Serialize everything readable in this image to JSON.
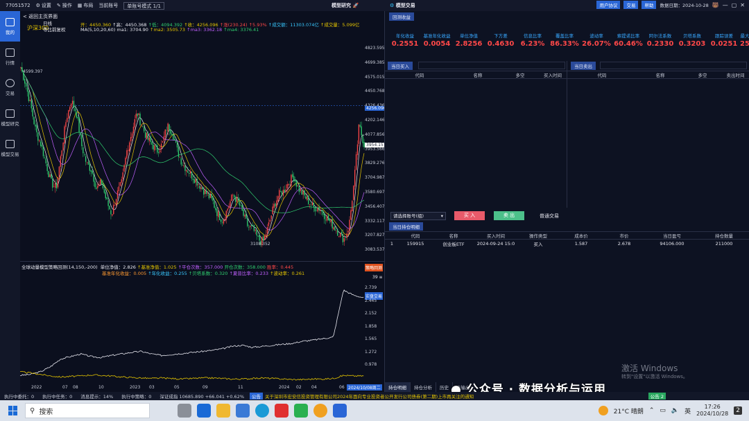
{
  "titlebar": {
    "account_id": "77051572",
    "settings": "设置",
    "operate": "操作",
    "layout": "布局",
    "current_account": "当前账号",
    "account_mode": "单账号模式 1/1",
    "center_title": "模型研究",
    "center_title2": "模型交易",
    "user_agreement": "用户协议",
    "trade": "交易",
    "help": "帮助",
    "data_date": "数据日期：2024-10-28"
  },
  "nav": [
    {
      "label": "我的",
      "active": true
    },
    {
      "label": "行情",
      "active": false
    },
    {
      "label": "交易",
      "active": false
    },
    {
      "label": "模型研究",
      "active": false
    },
    {
      "label": "模型交易",
      "active": false
    }
  ],
  "chart_header": {
    "back": "< 返回主页界面",
    "index_name": "沪深300",
    "period": "日线",
    "adjust": "等比前复权",
    "open": "开：4450.360",
    "high": "↑高：4450.368",
    "low": "↑低：4094.392",
    "close": "↑收：4256.096",
    "change": "↑涨(230.24)",
    "pct": "↑5.93%",
    "amount": "↑成交额：11303.074亿",
    "volume": "↑成交量：5.099亿",
    "ma_label": "MA(5,10,20,60)",
    "ma1": "ma1: 3704.90",
    "ma2": "↑ma2: 3505.73",
    "ma3": "↑ma3: 3362.18",
    "ma4": "↑ma4: 3376.41",
    "high_mark": "4599.397",
    "low_mark": "3108.352"
  },
  "price_axis": [
    "4823.595",
    "4699.385",
    "4575.015",
    "4450.768",
    "4326.436",
    "4202.146",
    "4077.856",
    "3953.566",
    "3829.276",
    "3704.987",
    "3580.697",
    "3456.407",
    "3332.117",
    "3207.827",
    "3083.537"
  ],
  "price_tags": {
    "current": "4256.096",
    "last": "3954.157"
  },
  "strategy": {
    "title": "全球动量模型策略回测(14,150,-200)",
    "unit_nav": "单位净值：2.826",
    "bench_nav": "↑基准净值：1.025",
    "avg_count": "↑平仓次数：357.000",
    "open_count": "开仓次数：358.000",
    "win_rate": "胜率：0.445",
    "bench_annual": "基准年化收益：0.005",
    "annual": "↑年化收益：0.255",
    "beta": "↑贝塔系数：0.320",
    "sharpe": "↑夏普比率：0.233",
    "volatility": "↑波动率：0.261",
    "btn_backtest": "策略回测",
    "btn_live": "实盘交易",
    "right_val": "39 ≡"
  },
  "strategy_axis": [
    "2.739",
    "2.445",
    "2.152",
    "1.858",
    "1.565",
    "1.272",
    "0.978"
  ],
  "x_axis": [
    "2022",
    "07",
    "08",
    "10",
    "2023",
    "03",
    "05",
    "09",
    "11",
    "2024",
    "02",
    "04",
    "06"
  ],
  "x_axis_end": "2024/10/08周二",
  "right": {
    "return_tab": "回测收益",
    "metrics": [
      {
        "label": "年化收益",
        "value": "0.2551"
      },
      {
        "label": "基准年化收益",
        "value": "0.0054"
      },
      {
        "label": "单位净值",
        "value": "2.8256"
      },
      {
        "label": "下方差",
        "value": "0.4630"
      },
      {
        "label": "信息比率",
        "value": "6.23%"
      },
      {
        "label": "覆盖比率",
        "value": "86.33%"
      },
      {
        "label": "波动率",
        "value": "26.07%"
      },
      {
        "label": "索提诺比率",
        "value": "60.46%"
      },
      {
        "label": "阿尔法系数",
        "value": "0.2330"
      },
      {
        "label": "贝塔系数",
        "value": "0.3203"
      },
      {
        "label": "跟踪误差",
        "value": "0.0251"
      },
      {
        "label": "最大",
        "value": "25."
      }
    ],
    "buy_tab": "当日买入",
    "sell_tab": "当日卖出",
    "buy_cols": [
      "代码",
      "名称",
      "多空",
      "买入时间"
    ],
    "sell_cols": [
      "代码",
      "名称",
      "多空",
      "卖出时间"
    ],
    "account_select": "请选择账号(组)",
    "buy_btn": "买 入",
    "sell_btn": "卖 出",
    "normal_trade": "普通交易",
    "holding_tab": "当日持仓明细",
    "holding_cols": [
      "",
      "代码",
      "名称",
      "买入时间",
      "操作类型",
      "成本价",
      "市价",
      "当日盈亏",
      "持仓数量"
    ],
    "holding_rows": [
      [
        "1",
        "159915",
        "创业板ETF",
        "2024-09-24 15:0",
        "买入",
        "1.587",
        "2.678",
        "94106.000",
        "211000"
      ]
    ],
    "bottom_tabs": [
      "持仓明细",
      "持仓分析",
      "历史",
      "表输出"
    ]
  },
  "watermark": {
    "line1": "激活 Windows",
    "line2": "转到\"设置\"以激活 Windows。"
  },
  "overlay_text": "公众号 · 数据分析与运用",
  "statusbar": {
    "s1": "执行中委托：0",
    "s2": "执行中任务：0",
    "s3": "消息提示：14%",
    "s4": "执行中策略：0",
    "s5": "深证成指 10685.890 +66.041 +0.62%",
    "notice_tag": "公告",
    "notice": "关于深圳市宏安信投资管理有限公司2024年面向专业投资者公开发行公司债券(第二期)上市再关注的通知",
    "green": "公告 2"
  },
  "taskbar": {
    "search": "搜索",
    "weather": "21°C 晴朗",
    "lang": "英",
    "time": "17:26",
    "date": "2024/10/28",
    "notif": "2"
  },
  "colors": {
    "accent": "#2a66d6",
    "up": "#ff4848",
    "down": "#30d070",
    "bg": "#0b0f1e"
  },
  "chart_data": [
    {
      "type": "candlestick",
      "title": "沪深300",
      "ylim": [
        3083.537,
        4823.595
      ],
      "x_ticks": [
        "2022",
        "07",
        "08",
        "10",
        "2023",
        "03",
        "05",
        "09",
        "11",
        "2024",
        "02",
        "04",
        "06"
      ],
      "series": [
        {
          "values": [
            4560,
            4420,
            4250,
            4050,
            3950,
            3800,
            3650,
            3600,
            3880,
            4150,
            4300,
            4200,
            3950,
            3800,
            3750,
            3600,
            3650,
            3500,
            3400,
            3550,
            3650,
            3900,
            4050,
            4200,
            4100,
            4000,
            3950,
            3900,
            3950,
            4100,
            4050,
            3900,
            3800,
            3750,
            3700,
            3650,
            3600,
            3550,
            3500,
            3400,
            3350,
            3450,
            3550,
            3500,
            3400,
            3300,
            3280,
            3200,
            3180,
            3300,
            3450,
            3550,
            3580,
            3650,
            3700,
            3600,
            3550,
            3500,
            3450,
            3450,
            3400,
            3350,
            3300,
            3250,
            3200,
            3300,
            3650,
            4100,
            3950
          ]
        }
      ]
    },
    {
      "type": "line",
      "title": "全球动量模型策略回测(14,150,-200)",
      "ylim": [
        0.978,
        2.739
      ],
      "series": [
        {
          "values": [
            1.03,
            1.05,
            1.1,
            1.2,
            1.35,
            1.4,
            1.45,
            1.4,
            1.38,
            1.42,
            1.45,
            1.48,
            1.5,
            1.45,
            1.42,
            1.44,
            1.46,
            1.48,
            1.5,
            1.52,
            1.55,
            1.6,
            1.62,
            1.58,
            1.6,
            1.62,
            1.64,
            1.66,
            1.7,
            1.72,
            1.75,
            1.78,
            2.7,
            2.6,
            2.55
          ]
        },
        {
          "values": [
            1.1,
            1.08,
            1.05,
            1.02,
            1.0,
            1.01,
            1.02,
            1.04,
            1.03,
            1.02,
            1.0,
            0.99,
            0.98,
            0.97,
            0.98,
            0.97,
            0.96,
            0.97,
            0.98,
            0.98,
            0.97,
            0.96,
            0.96,
            0.97,
            0.98,
            0.97,
            0.96,
            0.95,
            0.95,
            0.96,
            0.96,
            0.97,
            1.03,
            1.02,
            1.02
          ]
        }
      ]
    }
  ]
}
